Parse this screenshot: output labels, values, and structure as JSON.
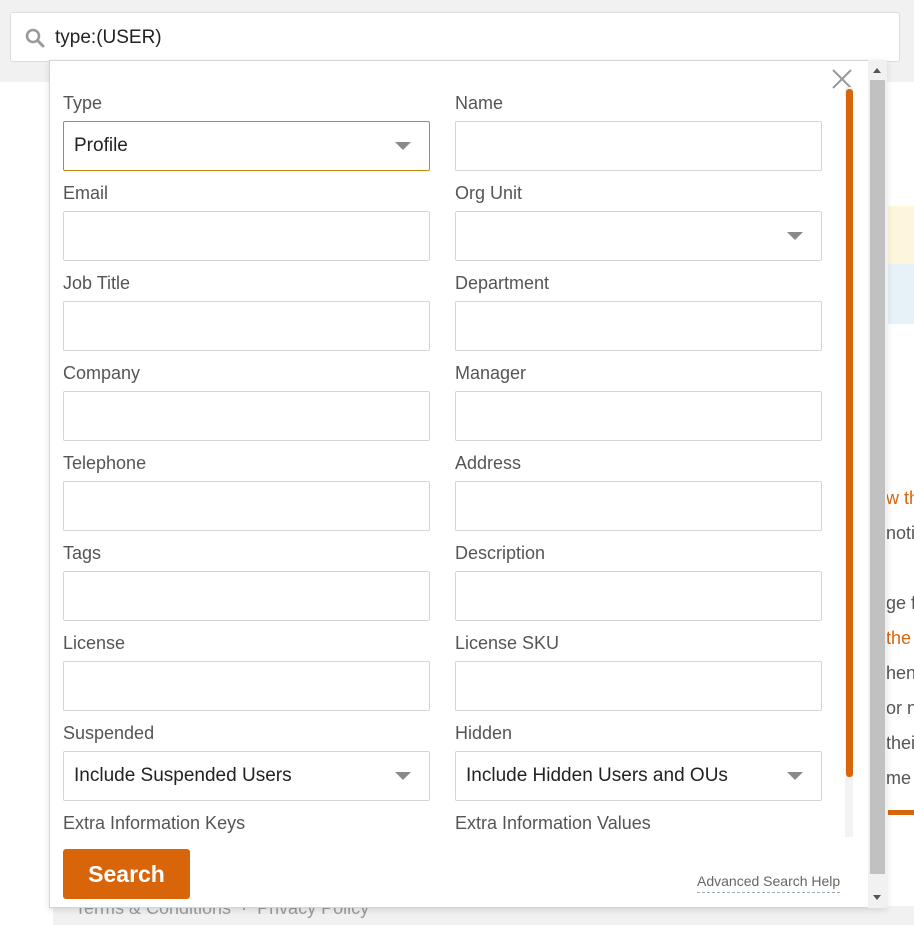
{
  "search": {
    "query": "type:(USER)",
    "icon": "search-icon"
  },
  "background": {
    "snippets": [
      {
        "text": "w th",
        "orange": true
      },
      {
        "text": "notif",
        "orange": false
      },
      {
        "text": "ge f",
        "orange": false
      },
      {
        "text": "the",
        "orange": true
      },
      {
        "text": "hen",
        "orange": false
      },
      {
        "text": "or n",
        "orange": false
      },
      {
        "text": "thei",
        "orange": false
      },
      {
        "text": "me",
        "orange": false
      }
    ]
  },
  "footer": {
    "terms": "Terms & Conditions",
    "separator": "·",
    "privacy": "Privacy Policy"
  },
  "panel": {
    "fields": {
      "type": {
        "label": "Type",
        "value": "Profile"
      },
      "name": {
        "label": "Name",
        "value": ""
      },
      "email": {
        "label": "Email",
        "value": ""
      },
      "org_unit": {
        "label": "Org Unit",
        "value": ""
      },
      "job_title": {
        "label": "Job Title",
        "value": ""
      },
      "department": {
        "label": "Department",
        "value": ""
      },
      "company": {
        "label": "Company",
        "value": ""
      },
      "manager": {
        "label": "Manager",
        "value": ""
      },
      "telephone": {
        "label": "Telephone",
        "value": ""
      },
      "address": {
        "label": "Address",
        "value": ""
      },
      "tags": {
        "label": "Tags",
        "value": ""
      },
      "description": {
        "label": "Description",
        "value": ""
      },
      "license": {
        "label": "License",
        "value": ""
      },
      "license_sku": {
        "label": "License SKU",
        "value": ""
      },
      "suspended": {
        "label": "Suspended",
        "value": "Include Suspended Users"
      },
      "hidden": {
        "label": "Hidden",
        "value": "Include Hidden Users and OUs"
      },
      "extra_keys": {
        "label": "Extra Information Keys"
      },
      "extra_values": {
        "label": "Extra Information Values"
      }
    },
    "search_button": "Search",
    "help_link": "Advanced Search Help"
  },
  "colors": {
    "accent": "#d9650b",
    "focus_border": "#c8860a",
    "light_yellow": "#fdf6dc",
    "light_blue": "#e6f1f8"
  }
}
